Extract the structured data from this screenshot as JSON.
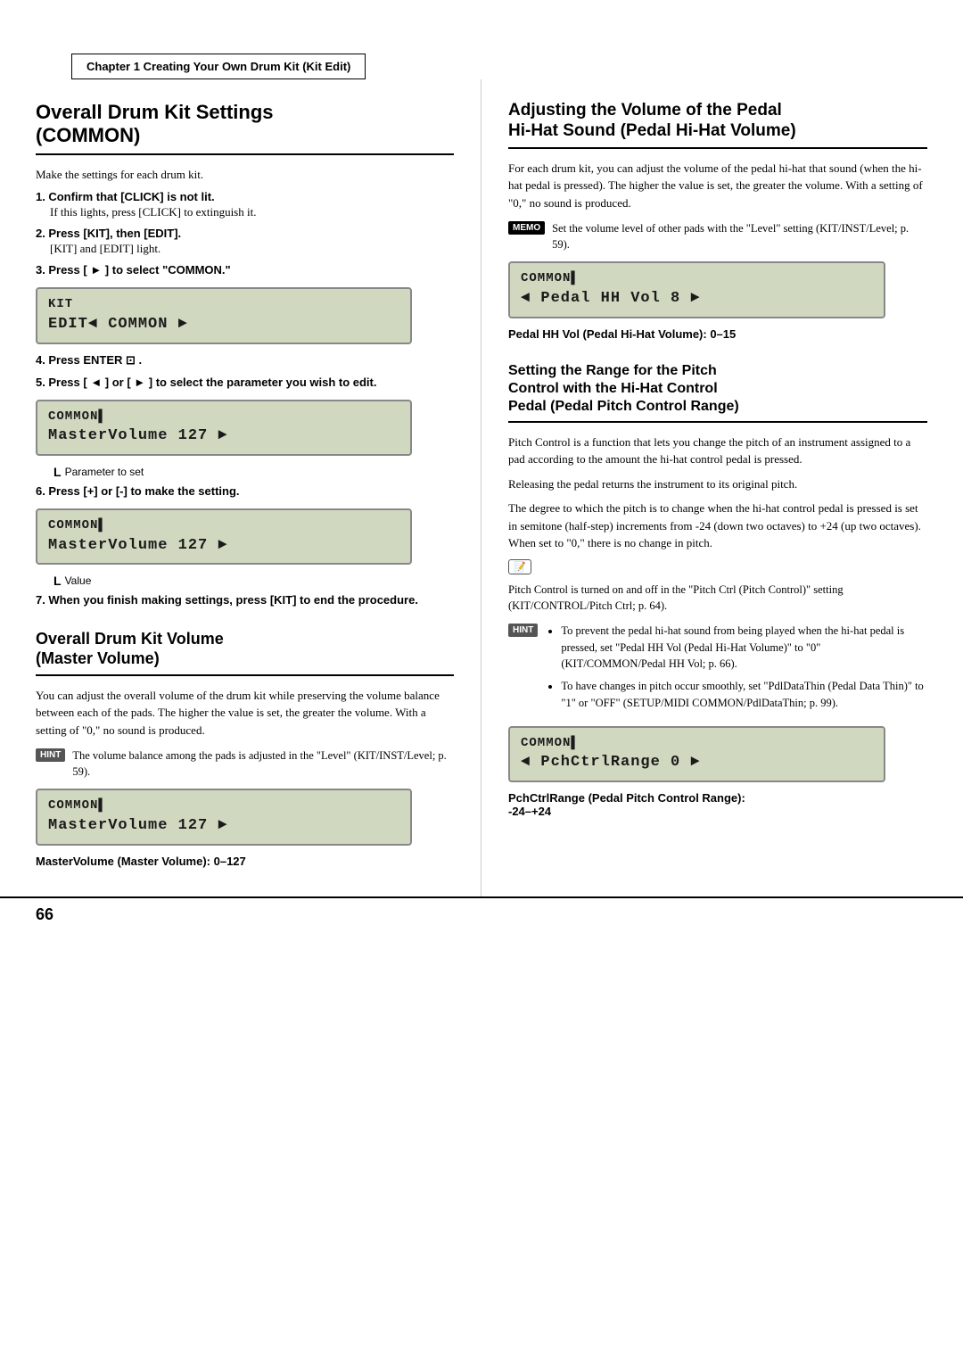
{
  "page": {
    "chapter_bar": "Chapter 1  Creating Your Own Drum Kit (Kit Edit)",
    "page_number": "66"
  },
  "left_column": {
    "main_title_line1": "Overall Drum Kit Settings",
    "main_title_line2": "(COMMON)",
    "intro": "Make the settings for each drum kit.",
    "steps": [
      {
        "num": "1.",
        "title": "Confirm that [CLICK] is not lit.",
        "sub": "If this lights, press [CLICK] to extinguish it."
      },
      {
        "num": "2.",
        "title": "Press [KIT], then [EDIT].",
        "sub": "[KIT] and [EDIT] light."
      },
      {
        "num": "3.",
        "title": "Press [ ► ] to select \"COMMON.\""
      }
    ],
    "lcd1_line1": "KIT",
    "lcd1_line2": "EDIT◄ COMMON    ►",
    "steps2": [
      {
        "num": "4.",
        "title": "Press ENTER ⊡ ."
      },
      {
        "num": "5.",
        "title": "Press [ ◄ ] or [ ► ] to select the parameter you wish to edit."
      }
    ],
    "lcd2_line1": "COMMON▌",
    "lcd2_line2": "MasterVolume  127  ►",
    "lcd2_annotation": "Parameter to set",
    "step6": {
      "num": "6.",
      "title": "Press [+] or [-] to make the setting."
    },
    "lcd3_line1": "COMMON▌",
    "lcd3_line2": "MasterVolume  127  ►",
    "lcd3_annotation": "Value",
    "step7": {
      "num": "7.",
      "title": "When you finish making settings, press [KIT] to end the procedure."
    },
    "subsection_title1": "Overall Drum Kit Volume",
    "subsection_title2": "(Master Volume)",
    "master_vol_text": "You can adjust the overall volume of the drum kit while preserving the volume balance between each of the pads. The higher the value is set, the greater the volume. With a setting of \"0,\" no sound is produced.",
    "hint_text": "The volume balance among the pads is adjusted in the \"Level\" (KIT/INST/Level; p. 59).",
    "lcd4_line1": "COMMON▌",
    "lcd4_line2": "MasterVolume  127  ►",
    "lcd4_caption": "MasterVolume (Master Volume): 0–127"
  },
  "right_column": {
    "title1_line1": "Adjusting the Volume of the Pedal",
    "title1_line2": "Hi-Hat Sound (Pedal Hi-Hat Volume)",
    "pedal_text": "For each drum kit, you can adjust the volume of the pedal hi-hat that sound (when the hi-hat pedal is pressed). The higher the value is set, the greater the volume. With a setting of \"0,\" no sound is produced.",
    "memo_text": "Set the volume level of other pads with the \"Level\" setting (KIT/INST/Level; p. 59).",
    "lcd_pedal_line1": "COMMON▌",
    "lcd_pedal_line2": "◄ Pedal HH Vol   8  ►",
    "lcd_pedal_caption": "Pedal HH Vol (Pedal Hi-Hat Volume): 0–15",
    "title2_line1": "Setting the Range for the Pitch",
    "title2_line2": "Control with the Hi-Hat Control",
    "title2_line3": "Pedal (Pedal Pitch Control Range)",
    "pitch_text1": "Pitch Control is a function that lets you change the pitch of an instrument assigned to a pad according to the amount the hi-hat control pedal is pressed.",
    "pitch_text2": "Releasing the pedal returns the instrument to its original pitch.",
    "pitch_text3": "The degree to which the pitch is to change when the hi-hat control pedal is pressed is set in semitone (half-step) increments from -24 (down two octaves) to +24 (up two octaves). When set to \"0,\" there is no change in pitch.",
    "note_text": "Pitch Control is turned on and off in the \"Pitch Ctrl (Pitch Control)\" setting (KIT/CONTROL/Pitch Ctrl; p. 64).",
    "hint_bullets": [
      "To prevent the pedal hi-hat sound from being played when the hi-hat pedal is pressed, set \"Pedal HH Vol (Pedal Hi-Hat Volume)\" to \"0\" (KIT/COMMON/Pedal HH Vol; p. 66).",
      "To have changes in pitch occur smoothly, set \"PdlDataThin (Pedal Data Thin)\" to \"1\" or \"OFF\" (SETUP/MIDI COMMON/PdlDataThin; p. 99)."
    ],
    "lcd_pitch_line1": "COMMON▌",
    "lcd_pitch_line2": "◄ PchCtrlRange   0  ►",
    "lcd_pitch_caption1": "PchCtrlRange (Pedal Pitch Control Range):",
    "lcd_pitch_caption2": "-24–+24"
  }
}
